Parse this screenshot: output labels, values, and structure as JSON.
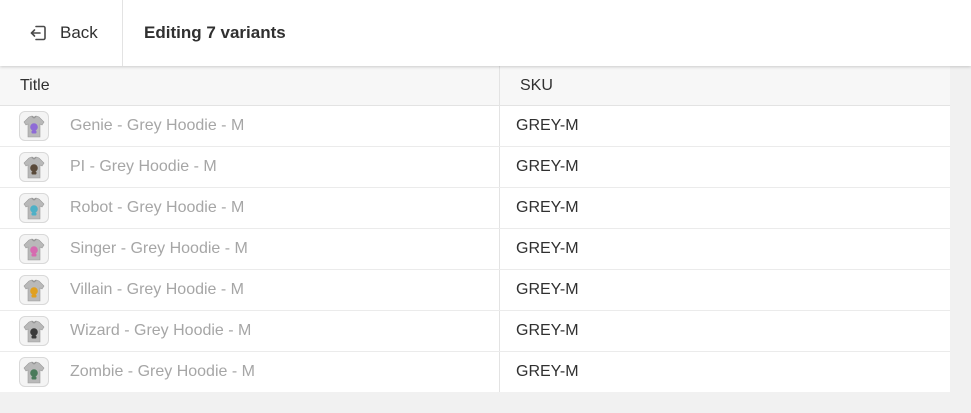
{
  "header": {
    "back_label": "Back",
    "title": "Editing 7 variants"
  },
  "table": {
    "columns": [
      "Title",
      "SKU"
    ],
    "rows": [
      {
        "title": "Genie - Grey Hoodie - M",
        "sku": "GREY-M",
        "accent": "#8e6bd6"
      },
      {
        "title": "PI - Grey Hoodie - M",
        "sku": "GREY-M",
        "accent": "#5a4a3a"
      },
      {
        "title": "Robot - Grey Hoodie - M",
        "sku": "GREY-M",
        "accent": "#4fb0c6"
      },
      {
        "title": "Singer - Grey Hoodie - M",
        "sku": "GREY-M",
        "accent": "#d66bb0"
      },
      {
        "title": "Villain - Grey Hoodie - M",
        "sku": "GREY-M",
        "accent": "#e0a020"
      },
      {
        "title": "Wizard - Grey Hoodie - M",
        "sku": "GREY-M",
        "accent": "#3a3a3a"
      },
      {
        "title": "Zombie - Grey Hoodie - M",
        "sku": "GREY-M",
        "accent": "#4a7a5a"
      }
    ]
  }
}
